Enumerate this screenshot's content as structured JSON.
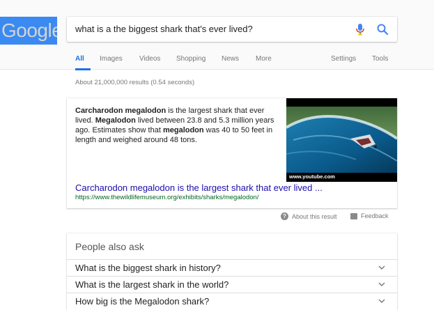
{
  "logo": {
    "text": "Google"
  },
  "search": {
    "query": "what is a the biggest shark that's ever lived?"
  },
  "tabs": [
    {
      "label": "All",
      "active": true
    },
    {
      "label": "Images"
    },
    {
      "label": "Videos"
    },
    {
      "label": "Shopping"
    },
    {
      "label": "News"
    },
    {
      "label": "More"
    }
  ],
  "tools": {
    "settings": "Settings",
    "tools": "Tools"
  },
  "stats": "About 21,000,000 results (0.54 seconds)",
  "featured": {
    "snippet": [
      {
        "text": "Carcharodon megalodon",
        "bold": true
      },
      {
        "text": " is the largest shark that ever lived. "
      },
      {
        "text": "Megalodon",
        "bold": true
      },
      {
        "text": " lived between 23.8 and 5.3 million years ago. Estimates show that "
      },
      {
        "text": "megalodon",
        "bold": true
      },
      {
        "text": " was 40 to 50 feet in length and weighed around 48 tons."
      }
    ],
    "image_caption": "www.youtube.com",
    "title": "Carcharodon megalodon is the largest shark that ever lived ...",
    "url": "https://www.thewildlifemuseum.org/exhibits/sharks/megalodon/"
  },
  "footer": {
    "about": "About this result",
    "feedback": "Feedback"
  },
  "people_also_ask": {
    "title": "People also ask",
    "questions": [
      "What is the biggest shark in history?",
      "What is the largest shark in the world?",
      "How big is the Megalodon shark?"
    ]
  },
  "colors": {
    "accent": "#1a73e8",
    "link": "#1a0dab",
    "url": "#006621",
    "logo_bg": "#3a8af1"
  }
}
